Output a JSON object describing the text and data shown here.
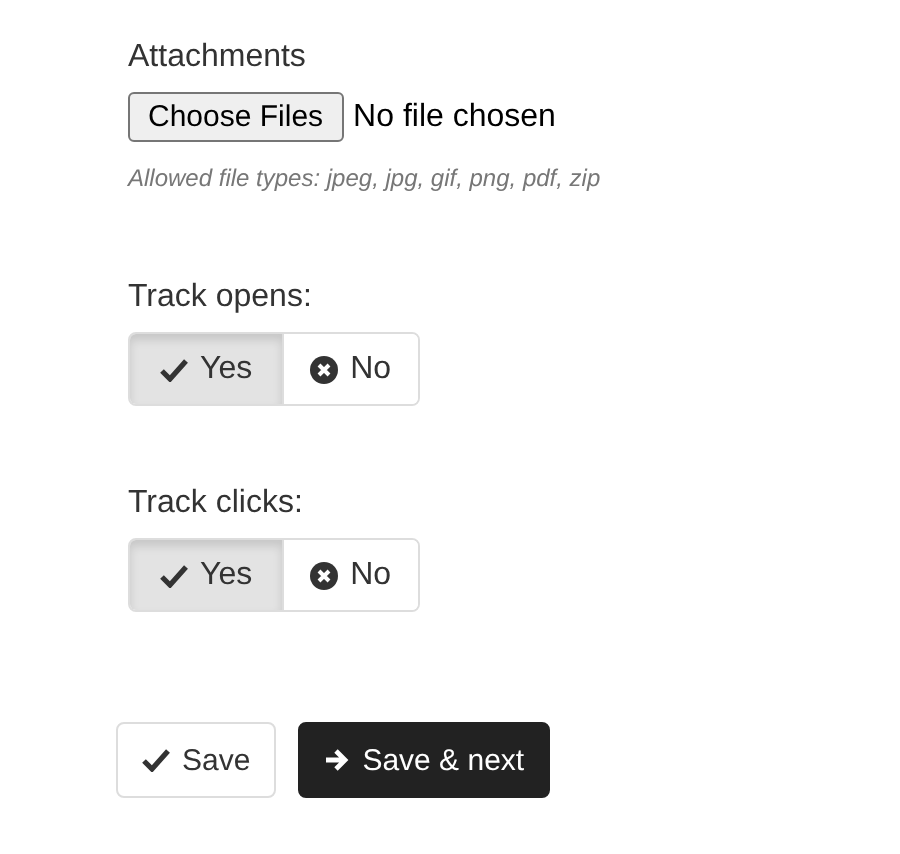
{
  "attachments": {
    "label": "Attachments",
    "button": "Choose Files",
    "status": "No file chosen",
    "hint": "Allowed file types: jpeg, jpg, gif, png, pdf, zip"
  },
  "toggles": [
    {
      "label": "Track opens:",
      "options": [
        {
          "label": "Yes",
          "selected": true
        },
        {
          "label": "No",
          "selected": false
        }
      ]
    },
    {
      "label": "Track clicks:",
      "options": [
        {
          "label": "Yes",
          "selected": true
        },
        {
          "label": "No",
          "selected": false
        }
      ]
    }
  ],
  "actions": [
    {
      "label": "Save",
      "kind": "default"
    },
    {
      "label": "Save & next",
      "kind": "dark"
    }
  ]
}
